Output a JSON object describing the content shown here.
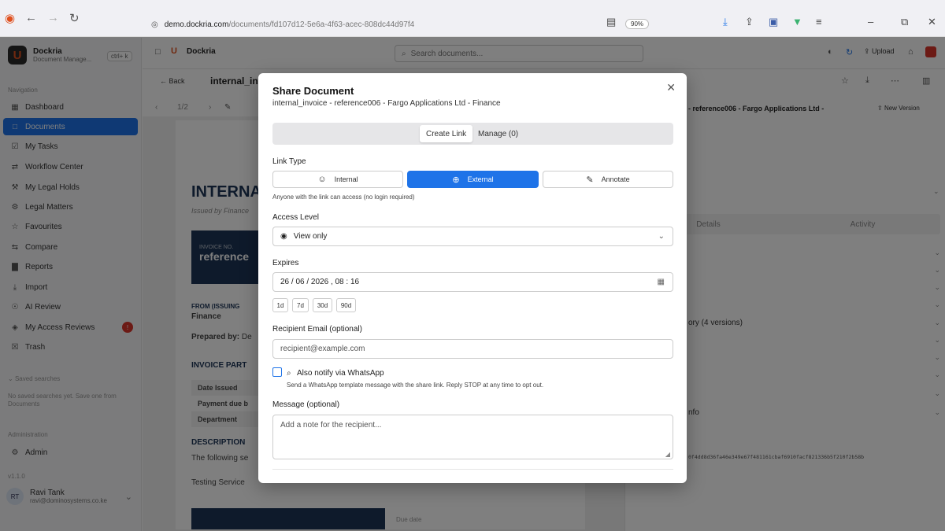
{
  "browser": {
    "url_host": "demo.dockria.com",
    "url_path": "/documents/fd107d12-5e6a-4f63-acec-808dc44d97f4",
    "zoom": "90%"
  },
  "app": {
    "brand_name": "Dockria",
    "brand_sub": "Document Manage...",
    "shortcut": "ctrl+ k",
    "top_title": "Dockria",
    "search_placeholder": "Search documents...",
    "upload_label": "Upload",
    "back_label": "Back",
    "doc_title": "internal_invo",
    "pager": "1/2",
    "new_version_label": "New Version",
    "right_title": "- reference006 - Fargo Applications Ltd -"
  },
  "sidebar": {
    "nav_label": "Navigation",
    "items": [
      {
        "label": "Dashboard",
        "icon": "grid-icon"
      },
      {
        "label": "Documents",
        "icon": "file-icon"
      },
      {
        "label": "My Tasks",
        "icon": "check-icon"
      },
      {
        "label": "Workflow Center",
        "icon": "workflow-icon"
      },
      {
        "label": "My Legal Holds",
        "icon": "gavel-icon"
      },
      {
        "label": "Legal Matters",
        "icon": "gear-icon"
      },
      {
        "label": "Favourites",
        "icon": "star-icon"
      },
      {
        "label": "Compare",
        "icon": "compare-icon"
      },
      {
        "label": "Reports",
        "icon": "chart-icon"
      },
      {
        "label": "Import",
        "icon": "import-icon"
      },
      {
        "label": "AI Review",
        "icon": "ai-icon"
      },
      {
        "label": "My Access Reviews",
        "icon": "shield-icon"
      },
      {
        "label": "Trash",
        "icon": "trash-icon"
      }
    ],
    "saved_label": "Saved searches",
    "saved_note": "No saved searches yet. Save one from Documents",
    "admin_section": "Administration",
    "admin_item": "Admin",
    "version": "v1.1.0",
    "user_initials": "RT",
    "user_name": "Ravi Tank",
    "user_email": "ravi@dominosystems.co.ke"
  },
  "document": {
    "heading": "INTERNA",
    "issued_by": "Issued by Finance",
    "invoice_no_label": "INVOICE NO.",
    "invoice_no": "reference",
    "from_label": "FROM (ISSUING",
    "from_value": "Finance",
    "prepared_label": "Prepared by:",
    "prepared_value": "De",
    "parties_label": "INVOICE PART",
    "rows": [
      "Date Issued",
      "Payment due b",
      "Department"
    ],
    "desc_label": "DESCRIPTION",
    "desc_text": "The following se",
    "service": "Testing Service",
    "due_label": "Due date"
  },
  "right_panel": {
    "tab_details": "Details",
    "tab_activity": "Activity",
    "history_label": "ory (4 versions)",
    "info_label": "nfo",
    "hash": "0f4dd8d36fa46e349e67f481161cbaf6910facf821336b5f210f2b58b"
  },
  "modal": {
    "title": "Share Document",
    "subtitle": "internal_invoice - reference006 - Fargo Applications Ltd - Finance",
    "tab_create": "Create Link",
    "tab_manage": "Manage (0)",
    "link_type_label": "Link Type",
    "link_types": [
      "Internal",
      "External",
      "Annotate"
    ],
    "link_hint": "Anyone with the link can access (no login required)",
    "access_label": "Access Level",
    "access_value": "View only",
    "expires_label": "Expires",
    "expires_value": "26 / 06 / 2026 ,  08 : 16",
    "expiry_presets": [
      "1d",
      "7d",
      "30d",
      "90d"
    ],
    "email_label": "Recipient Email (optional)",
    "email_placeholder": "recipient@example.com",
    "whatsapp_label": "Also notify via WhatsApp",
    "whatsapp_hint": "Send a WhatsApp template message with the share link. Reply STOP at any time to opt out.",
    "message_label": "Message (optional)",
    "message_placeholder": "Add a note for the recipient..."
  },
  "colors": {
    "accent": "#1e73e8",
    "brand_orange": "#e0501e",
    "doc_navy": "#1d3557"
  }
}
